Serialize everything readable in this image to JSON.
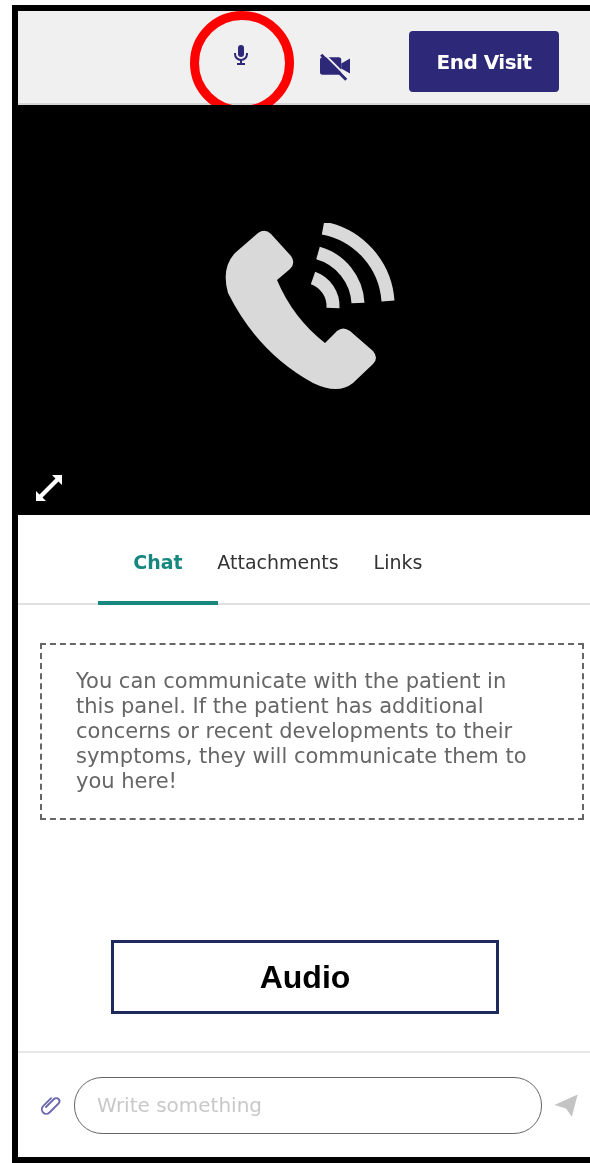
{
  "toolbar": {
    "microphone": {
      "on": true,
      "highlighted": true
    },
    "camera": {
      "on": false
    },
    "end_button": "End Visit"
  },
  "tabs": [
    {
      "label": "Chat",
      "selected": true
    },
    {
      "label": "Attachments",
      "selected": false
    },
    {
      "label": "Links",
      "selected": false
    }
  ],
  "chat_notice": "You can communicate with the patient in this panel. If the patient has additional concerns or recent developments to their symptoms, they will communicate them to you here!",
  "callout": "Audio",
  "composer": {
    "placeholder": "Write something"
  }
}
